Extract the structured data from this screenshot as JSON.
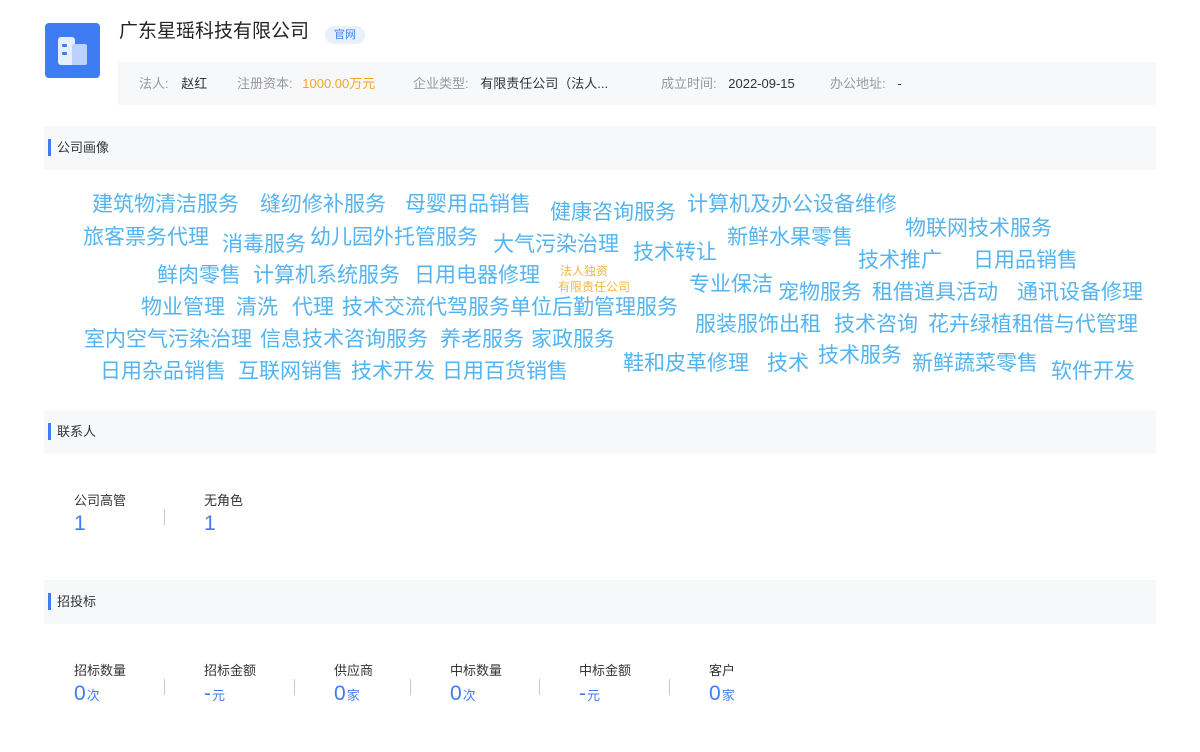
{
  "company": {
    "name": "广东星瑶科技有限公司",
    "official_badge": "官网"
  },
  "info": {
    "legal_rep_label": "法人:",
    "legal_rep_value": "赵红",
    "capital_label": "注册资本:",
    "capital_value": "1000.00万元",
    "type_label": "企业类型:",
    "type_value": "有限责任公司（法人...",
    "founded_label": "成立时间:",
    "founded_value": "2022-09-15",
    "address_label": "办公地址:",
    "address_value": "-"
  },
  "sections": {
    "profile_title": "公司画像",
    "contacts_title": "联系人",
    "bidding_title": "招投标"
  },
  "tags": [
    "建筑物清洁服务",
    "缝纫修补服务",
    "母婴用品销售",
    "健康咨询服务",
    "计算机及办公设备维修",
    "旅客票务代理",
    "消毒服务",
    "幼儿园外托管服务",
    "大气污染治理",
    "技术转让",
    "新鲜水果零售",
    "物联网技术服务",
    "鲜肉零售",
    "计算机系统服务",
    "日用电器修理",
    "技术推广",
    "日用品销售",
    "专业保洁",
    "宠物服务",
    "租借道具活动",
    "通讯设备修理",
    "物业管理",
    "清洗",
    "代理",
    "技术交流",
    "代驾服务",
    "单位后勤管理服务",
    "服装服饰出租",
    "技术咨询",
    "花卉绿植租借与代管理",
    "室内空气污染治理",
    "信息技术咨询服务",
    "养老服务",
    "家政服务",
    "日用杂品销售",
    "互联网销售",
    "技术开发",
    "日用百货销售",
    "鞋和皮革修理",
    "技术",
    "技术服务",
    "新鲜蔬菜零售",
    "软件开发"
  ],
  "tag_center": {
    "line1": "法人独资",
    "line2": "有限责任公司"
  },
  "contacts": [
    {
      "label": "公司高管",
      "value": "1"
    },
    {
      "label": "无角色",
      "value": "1"
    }
  ],
  "bidding": [
    {
      "label": "招标数量",
      "value": "0",
      "unit": "次"
    },
    {
      "label": "招标金额",
      "value": "-",
      "unit": "元"
    },
    {
      "label": "供应商",
      "value": "0",
      "unit": "家"
    },
    {
      "label": "中标数量",
      "value": "0",
      "unit": "次"
    },
    {
      "label": "中标金额",
      "value": "-",
      "unit": "元"
    },
    {
      "label": "客户",
      "value": "0",
      "unit": "家"
    }
  ]
}
